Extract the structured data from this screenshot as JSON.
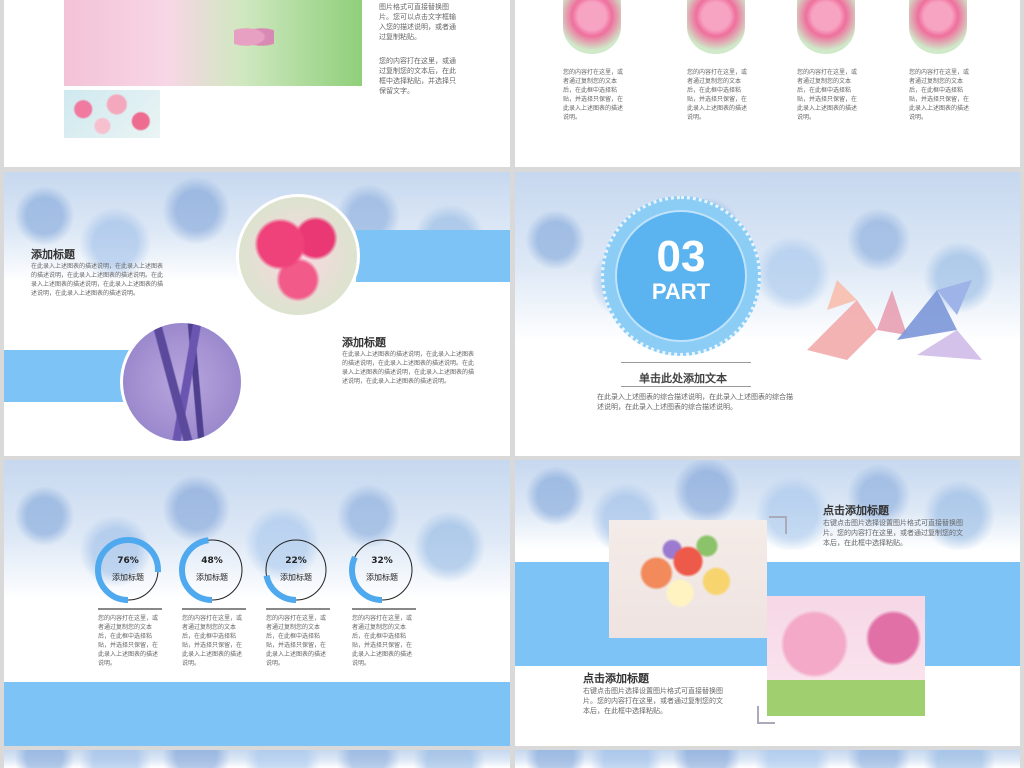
{
  "slide1": {
    "text1": "图片格式可直接替换图片。您可以点击文字框输入您的描述说明，或者通过复制粘贴。",
    "text2": "您的内容打在这里，或通过复制您的文本后，在此框中选择粘贴，并选择只保留文字。"
  },
  "slide2": {
    "captions": [
      "您的内容打在这里，或者通过复制您的文本后，在此框中选择粘贴，并选择只保留，在此录入上述图表的描述说明。",
      "您的内容打在这里，或者通过复制您的文本后，在此框中选择粘贴，并选择只保留，在此录入上述图表的描述说明。",
      "您的内容打在这里，或者通过复制您的文本后，在此框中选择粘贴，并选择只保留，在此录入上述图表的描述说明。",
      "您的内容打在这里，或者通过复制您的文本后，在此框中选择粘贴，并选择只保留，在此录入上述图表的描述说明。"
    ]
  },
  "slide3": {
    "title1": "添加标题",
    "body1": "在此录入上述图表的描述说明，在此录入上述图表的描述说明，在此录入上述图表的描述说明。在此录入上述图表的描述说明，在此录入上述图表的描述说明，在此录入上述图表的描述说明。",
    "title2": "添加标题",
    "body2": "在此录入上述图表的描述说明，在此录入上述图表的描述说明，在此录入上述图表的描述说明。在此录入上述图表的描述说明，在此录入上述图表的描述说明，在此录入上述图表的描述说明。"
  },
  "slide4": {
    "number": "03",
    "part": "PART",
    "subtitle": "单击此处添加文本",
    "body": "在此录入上述图表的综合描述说明，在此录入上述图表的综合描述说明，在此录入上述图表的综合描述说明。"
  },
  "slide5": {
    "items": [
      {
        "pct": "76%",
        "value": 76,
        "label": "添加标题",
        "desc": "您的内容打在这里，或者通过复制您的文本后，在此框中选择粘贴，并选择只保留，在此录入上述图表的描述说明。"
      },
      {
        "pct": "48%",
        "value": 48,
        "label": "添加标题",
        "desc": "您的内容打在这里，或者通过复制您的文本后，在此框中选择粘贴，并选择只保留，在此录入上述图表的描述说明。"
      },
      {
        "pct": "22%",
        "value": 22,
        "label": "添加标题",
        "desc": "您的内容打在这里，或者通过复制您的文本后，在此框中选择粘贴，并选择只保留，在此录入上述图表的描述说明。"
      },
      {
        "pct": "32%",
        "value": 32,
        "label": "添加标题",
        "desc": "您的内容打在这里，或者通过复制您的文本后，在此框中选择粘贴，并选择只保留，在此录入上述图表的描述说明。"
      }
    ]
  },
  "slide6": {
    "title1": "点击添加标题",
    "body1": "右键点击图片选择设置图片格式可直接替换图片。您的内容打在这里，或者通过复制您的文本后，在此框中选择粘贴。",
    "title2": "点击添加标题",
    "body2": "右键点击图片选择设置图片格式可直接替换图片。您的内容打在这里，或者通过复制您的文本后，在此框中选择粘贴。"
  },
  "colors": {
    "accent_blue": "#7ec3f5",
    "ring_blue": "#4fa9ee",
    "badge_blue": "#5bb3f0"
  }
}
